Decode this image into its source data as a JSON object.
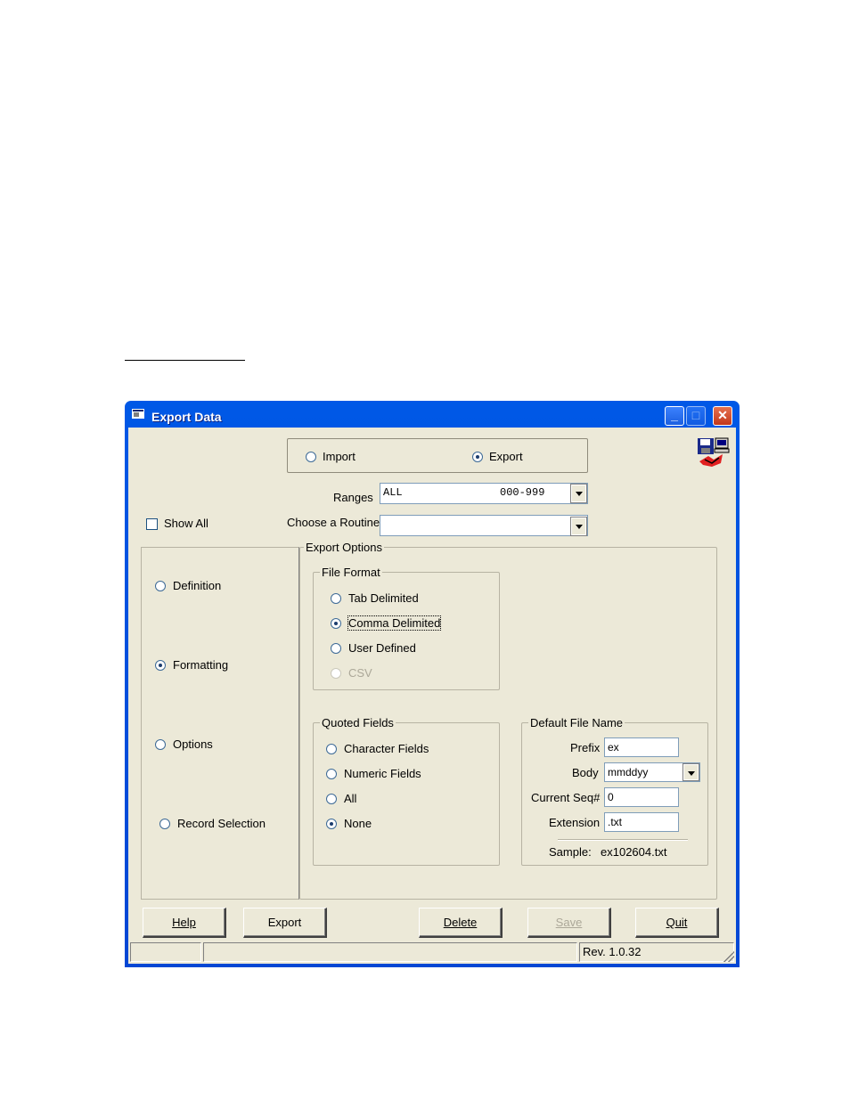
{
  "window": {
    "title": "Export Data",
    "minimize_label": "_",
    "maximize_label": "□",
    "close_label": "✕",
    "app_icon": "floppy-disk-computer-icon"
  },
  "mode": {
    "import_label": "Import",
    "export_label": "Export",
    "selected": "Export"
  },
  "ranges": {
    "label": "Ranges",
    "value_name": "ALL",
    "value_range": "000-999"
  },
  "routine": {
    "label": "Choose a Routine",
    "value": ""
  },
  "show_all": {
    "label": "Show All",
    "checked": false
  },
  "nav": {
    "items": [
      {
        "label": "Definition",
        "checked": false
      },
      {
        "label": "Formatting",
        "checked": true
      },
      {
        "label": "Options",
        "checked": false
      },
      {
        "label": "Record Selection",
        "checked": false
      }
    ]
  },
  "export_options": {
    "title": "Export Options",
    "file_format": {
      "title": "File Format",
      "options": [
        {
          "label": "Tab Delimited",
          "checked": false,
          "disabled": false
        },
        {
          "label": "Comma Delimited",
          "checked": true,
          "disabled": false
        },
        {
          "label": "User Defined",
          "checked": false,
          "disabled": false
        },
        {
          "label": "CSV",
          "checked": false,
          "disabled": true
        }
      ]
    },
    "quoted_fields": {
      "title": "Quoted Fields",
      "options": [
        {
          "label": "Character Fields",
          "checked": false
        },
        {
          "label": "Numeric Fields",
          "checked": false
        },
        {
          "label": "All",
          "checked": false
        },
        {
          "label": "None",
          "checked": true
        }
      ]
    },
    "default_file_name": {
      "title": "Default File Name",
      "prefix_label": "Prefix",
      "prefix_value": "ex",
      "body_label": "Body",
      "body_value": "mmddyy",
      "seq_label": "Current Seq#",
      "seq_value": "0",
      "extension_label": "Extension",
      "extension_value": ".txt",
      "sample_label": "Sample:",
      "sample_value": "ex102604.txt"
    }
  },
  "buttons": {
    "help": "Help",
    "export": "Export",
    "delete": "Delete",
    "save": "Save",
    "quit": "Quit"
  },
  "status": {
    "panel1": "",
    "panel2": "",
    "revision": "Rev. 1.0.32"
  }
}
